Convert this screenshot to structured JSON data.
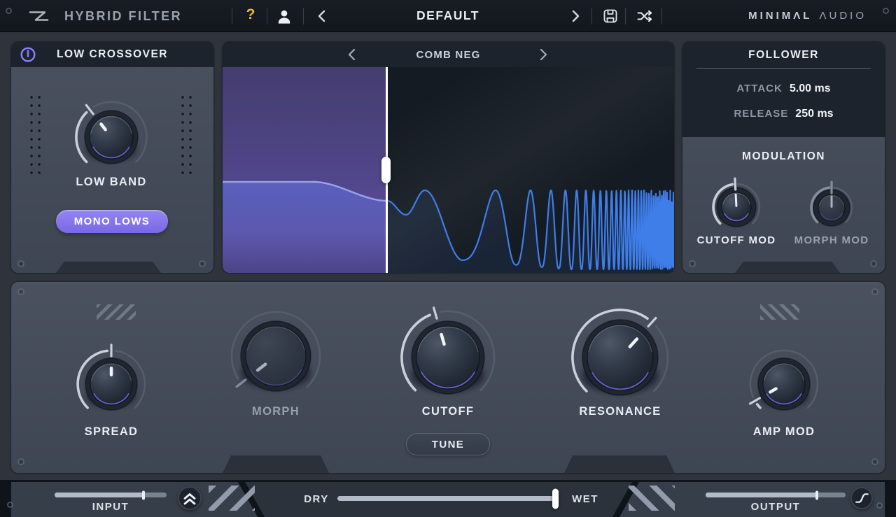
{
  "titlebar": {
    "title": "HYBRID FILTER",
    "help": "?",
    "preset": "DEFAULT",
    "brand_primary": "MINIMΛL",
    "brand_secondary": "ΛUDIO"
  },
  "low_crossover": {
    "title": "LOW CROSSOVER",
    "mono_lows": "MONO LOWS"
  },
  "visualizer": {
    "filter_type": "COMB NEG",
    "crossover_fraction": 0.364
  },
  "follower": {
    "title": "FOLLOWER",
    "params": [
      {
        "label": "ATTACK",
        "value": "5.00 ms"
      },
      {
        "label": "RELEASE",
        "value": "250 ms"
      }
    ]
  },
  "modulation": {
    "title": "MODULATION"
  },
  "knobs": {
    "low_band": {
      "label": "LOW BAND",
      "angle": -38,
      "dim": false
    },
    "cutoff_mod": {
      "label": "CUTOFF MOD",
      "angle": -3,
      "dim": false
    },
    "morph_mod": {
      "label": "MORPH MOD",
      "angle": 0,
      "dim": true
    },
    "spread": {
      "label": "SPREAD",
      "angle": 0,
      "dim": false
    },
    "morph": {
      "label": "MORPH",
      "angle": -128,
      "dim": true
    },
    "cutoff": {
      "label": "CUTOFF",
      "angle": -16,
      "dim": false
    },
    "resonance": {
      "label": "RESONANCE",
      "angle": 42,
      "dim": false
    },
    "amp_mod": {
      "label": "AMP MOD",
      "angle": -120,
      "dim": false
    }
  },
  "buttons": {
    "tune": "TUNE"
  },
  "footer": {
    "input_label": "INPUT",
    "output_label": "OUTPUT",
    "dry_label": "DRY",
    "wet_label": "WET",
    "input_fraction": 0.8,
    "output_fraction": 0.8,
    "mix_fraction": 1.0
  },
  "colors": {
    "accent_purple": "#8b7cf2",
    "mono_button_purple": "#8473ea",
    "comb_blue": "#3f7de8",
    "left_curve_purple": "#9aa2e8",
    "arc_bright": "#c9d0da",
    "panel": "#454c59",
    "panel_header": "#1c232c",
    "background": "#2e333c",
    "help_gold": "#e9b93a"
  }
}
